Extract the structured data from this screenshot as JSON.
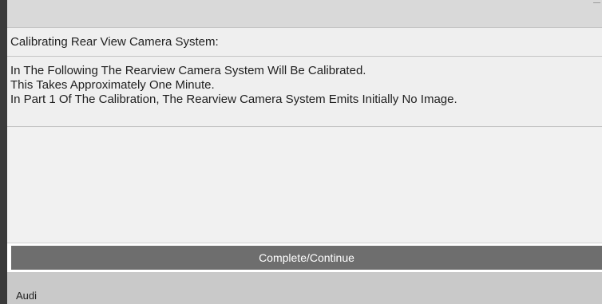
{
  "header": {
    "title": "Calibrating Rear View Camera System:"
  },
  "message": {
    "lines": [
      "In The Following The Rearview Camera System Will Be Calibrated.",
      "This Takes Approximately One Minute.",
      "In Part 1 Of The Calibration, The Rearview Camera System Emits Initially No Image."
    ]
  },
  "actions": {
    "continue_label": "Complete/Continue"
  },
  "footer": {
    "vehicle_label": "Audi"
  }
}
